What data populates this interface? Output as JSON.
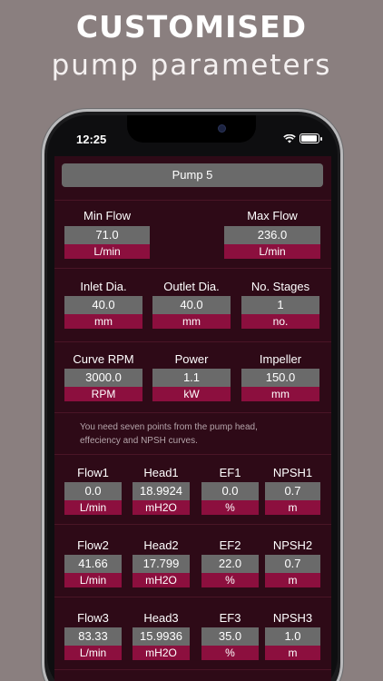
{
  "promo": {
    "title": "CUSTOMISED",
    "subtitle": "pump parameters"
  },
  "status_bar": {
    "time": "12:25"
  },
  "pump": {
    "name": "Pump 5"
  },
  "flow_limits": {
    "min": {
      "label": "Min Flow",
      "value": "71.0",
      "unit": "L/min"
    },
    "max": {
      "label": "Max  Flow",
      "value": "236.0",
      "unit": "L/min"
    }
  },
  "dimensions": [
    {
      "label": "Inlet Dia.",
      "value": "40.0",
      "unit": "mm"
    },
    {
      "label": "Outlet Dia.",
      "value": "40.0",
      "unit": "mm"
    },
    {
      "label": "No. Stages",
      "value": "1",
      "unit": "no."
    }
  ],
  "motor": [
    {
      "label": "Curve RPM",
      "value": "3000.0",
      "unit": "RPM"
    },
    {
      "label": "Power",
      "value": "1.1",
      "unit": "kW"
    },
    {
      "label": "Impeller",
      "value": "150.0",
      "unit": "mm"
    }
  ],
  "note": "You need seven points from the pump head, effeciency and NPSH curves.",
  "curve_points": [
    [
      {
        "label": "Flow1",
        "value": "0.0",
        "unit": "L/min"
      },
      {
        "label": "Head1",
        "value": "18.9924",
        "unit": "mH2O"
      },
      {
        "label": "EF1",
        "value": "0.0",
        "unit": "%"
      },
      {
        "label": "NPSH1",
        "value": "0.7",
        "unit": "m"
      }
    ],
    [
      {
        "label": "Flow2",
        "value": "41.66",
        "unit": "L/min"
      },
      {
        "label": "Head2",
        "value": "17.799",
        "unit": "mH2O"
      },
      {
        "label": "EF2",
        "value": "22.0",
        "unit": "%"
      },
      {
        "label": "NPSH2",
        "value": "0.7",
        "unit": "m"
      }
    ],
    [
      {
        "label": "Flow3",
        "value": "83.33",
        "unit": "L/min"
      },
      {
        "label": "Head3",
        "value": "15.9936",
        "unit": "mH2O"
      },
      {
        "label": "EF3",
        "value": "35.0",
        "unit": "%"
      },
      {
        "label": "NPSH3",
        "value": "1.0",
        "unit": "m"
      }
    ]
  ]
}
